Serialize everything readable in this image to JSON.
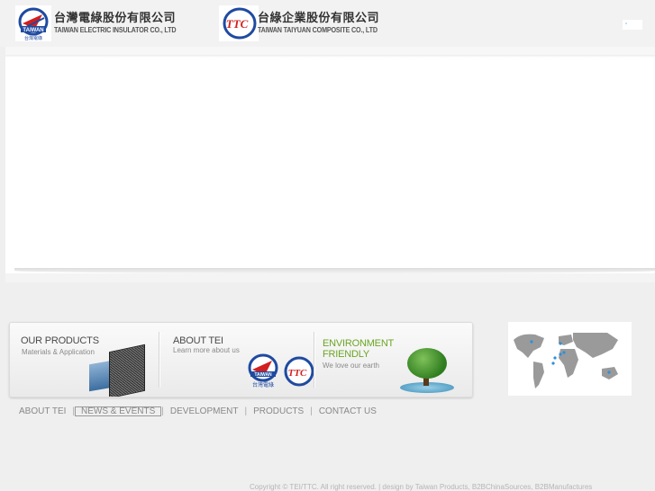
{
  "header": {
    "logos": [
      {
        "zh": "台灣電綠股份有限公司",
        "en": "TAIWAN ELECTRIC INSULATOR CO., LTD",
        "mark_text": "TAIWAN",
        "mark_sub": "台灣電綠"
      },
      {
        "zh": "台綠企業股份有限公司",
        "en": "TAIWAN TAIYUAN COMPOSITE CO., LTD",
        "mark_text": "TTC"
      }
    ],
    "lang_icon": "flag-icon"
  },
  "features": {
    "products": {
      "title": "OUR PRODUCTS",
      "subtitle": "Materials & Application"
    },
    "about": {
      "title": "ABOUT TEI",
      "subtitle": "Learn more about us",
      "mark_tei": "TAIWAN",
      "mark_tei_sub": "台灣電綠",
      "mark_ttc": "TTC"
    },
    "environment": {
      "title": "ENVIRONMENT FRIENDLY",
      "subtitle": "We love our earth"
    }
  },
  "map": {
    "icon": "world-map-icon"
  },
  "nav": {
    "items": [
      {
        "label": "ABOUT TEI"
      },
      {
        "label": "NEWS & EVENTS"
      },
      {
        "label": "DEVELOPMENT"
      },
      {
        "label": "PRODUCTS"
      },
      {
        "label": "CONTACT US"
      }
    ],
    "separator": "|"
  },
  "footer": {
    "text": "Copyright © TEI/TTC. All right reserved. | design by Taiwan Products, B2BChinaSources, B2BManufactures"
  },
  "colors": {
    "accent_green": "#6aa624",
    "logo_red": "#d21f1f",
    "logo_blue": "#1f4aa0"
  }
}
